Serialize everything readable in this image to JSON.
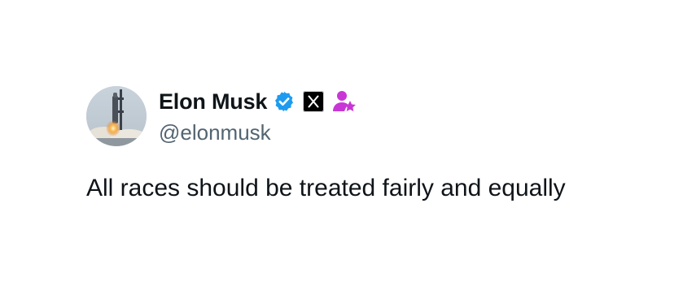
{
  "tweet": {
    "author": {
      "display_name": "Elon Musk",
      "handle": "@elonmusk",
      "avatar": "rocket-launch-photo",
      "badges": [
        "verified-icon",
        "x-affiliate-icon",
        "person-star-icon"
      ]
    },
    "text": "All races should be treated fairly and equally"
  },
  "colors": {
    "verified_blue": "#1d9bf0",
    "handle_gray": "#536471",
    "text_black": "#0f1419",
    "role_badge_pink": "#c837d6"
  }
}
